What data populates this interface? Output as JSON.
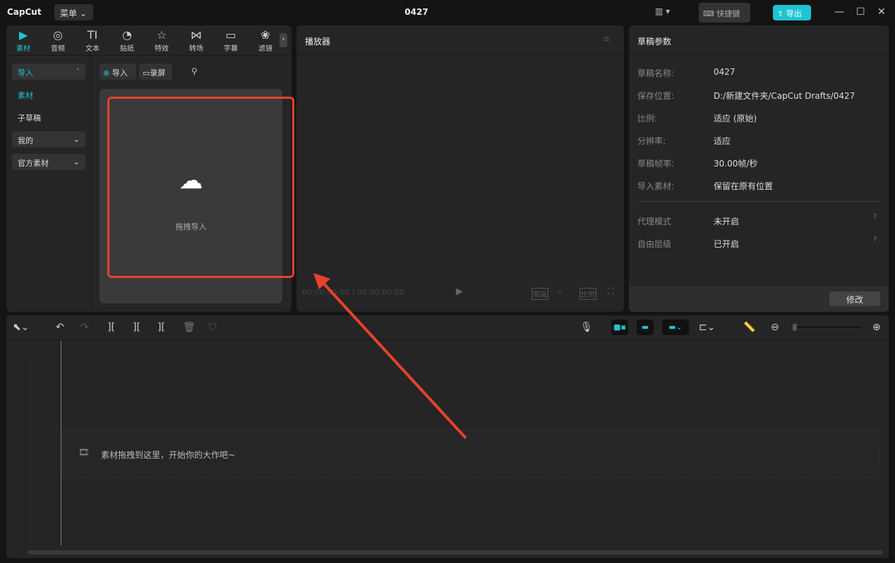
{
  "app": {
    "logo": "CapCut",
    "menu": "菜单",
    "title": "0427",
    "shortcuts": "快捷键",
    "export": "导出"
  },
  "tabs": [
    {
      "label": "素材",
      "icon": "▶"
    },
    {
      "label": "音频",
      "icon": "◎"
    },
    {
      "label": "文本",
      "icon": "TI"
    },
    {
      "label": "贴纸",
      "icon": "◔"
    },
    {
      "label": "特效",
      "icon": "☆"
    },
    {
      "label": "转场",
      "icon": "⋈"
    },
    {
      "label": "字幕",
      "icon": "▭"
    },
    {
      "label": "滤镜",
      "icon": "❀"
    }
  ],
  "sidebar": {
    "import": "导入",
    "material": "素材",
    "subdraft": "子草稿",
    "mine": "我的",
    "official": "官方素材"
  },
  "media": {
    "import_btn": "导入",
    "record_btn": "录屏",
    "drop_text": "拖拽导入"
  },
  "player": {
    "title": "播放器",
    "time": "00:00:00:00 / 00:00:00:00",
    "original": "原画",
    "ratio": "比例"
  },
  "draft": {
    "title": "草稿参数",
    "rows": [
      {
        "k": "草稿名称:",
        "v": "0427"
      },
      {
        "k": "保存位置:",
        "v": "D:/新建文件夹/CapCut Drafts/0427"
      },
      {
        "k": "比例:",
        "v": "适应 (原始)"
      },
      {
        "k": "分辨率:",
        "v": "适应"
      },
      {
        "k": "草稿帧率:",
        "v": "30.00帧/秒"
      },
      {
        "k": "导入素材:",
        "v": "保留在原有位置"
      }
    ],
    "proxy_k": "代理模式",
    "proxy_v": "未开启",
    "layer_k": "自由层级",
    "layer_v": "已开启",
    "modify": "修改"
  },
  "timeline": {
    "hint": "素材拖拽到这里，开始你的大作吧~"
  },
  "colors": {
    "accent": "#1fc4d0",
    "annotation": "#e8412c"
  }
}
